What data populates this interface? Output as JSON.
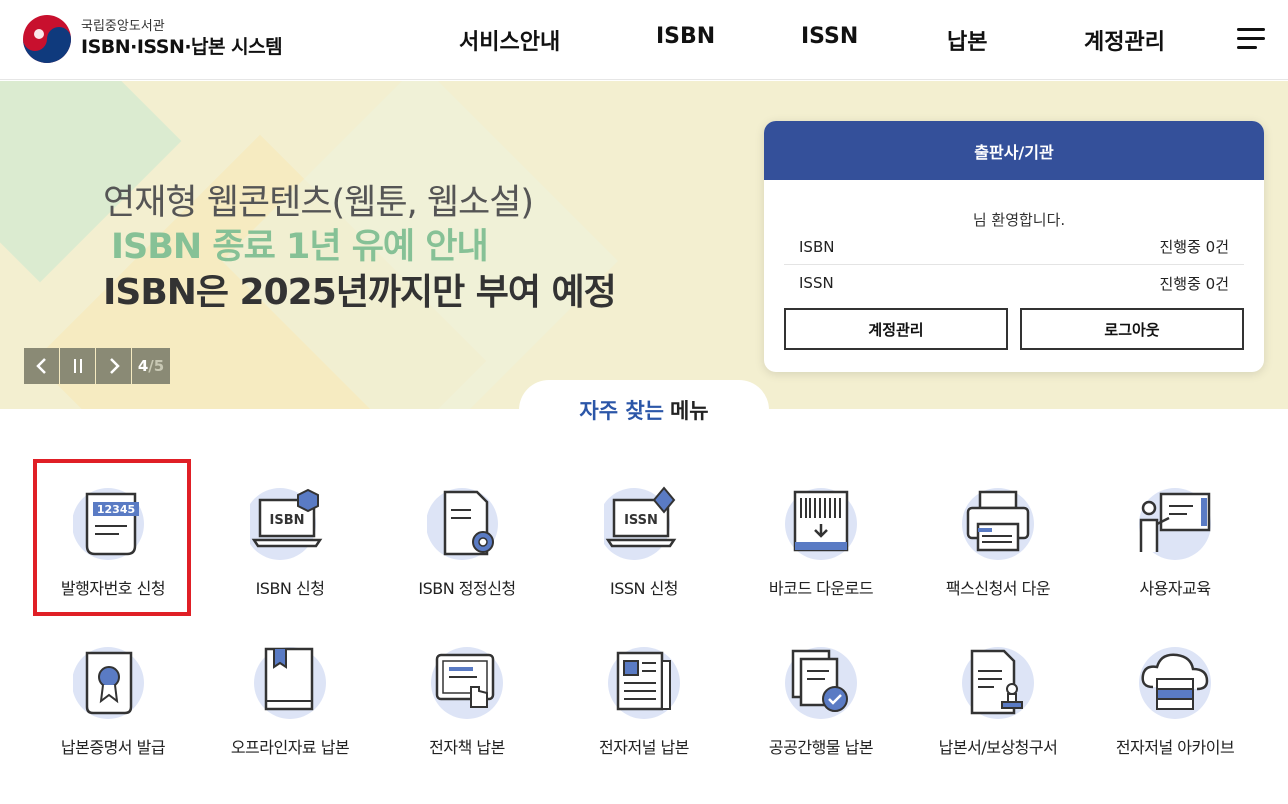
{
  "header": {
    "logo_small": "국립중앙도서관",
    "logo_main": "ISBN·ISSN·납본 시스템",
    "nav": [
      "서비스안내",
      "ISBN",
      "ISSN",
      "납본",
      "계정관리"
    ],
    "menu_icon": "hamburger-icon"
  },
  "banner": {
    "line1": "연재형 웹콘텐츠(웹툰, 웹소설)",
    "line2": "ISBN 종료 1년 유예 안내",
    "line3": "ISBN은 2025년까지만 부여 예정",
    "page_current": "4",
    "page_total": "/5"
  },
  "login_card": {
    "title": "출판사/기관",
    "welcome": "님 환영합니다.",
    "rows": [
      {
        "label": "ISBN",
        "status": "진행중 0건"
      },
      {
        "label": "ISSN",
        "status": "진행중 0건"
      }
    ],
    "account_button": "계정관리",
    "logout_button": "로그아웃"
  },
  "frequent_menu": {
    "title_highlight": "자주 찾는",
    "title_rest": "메뉴",
    "items": [
      {
        "label": "발행자번호 신청",
        "icon": "publisher-number-icon"
      },
      {
        "label": "ISBN 신청",
        "icon": "isbn-laptop-icon"
      },
      {
        "label": "ISBN 정정신청",
        "icon": "document-gear-icon"
      },
      {
        "label": "ISSN 신청",
        "icon": "issn-laptop-icon"
      },
      {
        "label": "바코드 다운로드",
        "icon": "barcode-download-icon"
      },
      {
        "label": "팩스신청서 다운",
        "icon": "fax-icon"
      },
      {
        "label": "사용자교육",
        "icon": "presentation-icon"
      },
      {
        "label": "납본증명서 발급",
        "icon": "certificate-icon"
      },
      {
        "label": "오프라인자료 납본",
        "icon": "book-icon"
      },
      {
        "label": "전자책 납본",
        "icon": "tablet-touch-icon"
      },
      {
        "label": "전자저널 납본",
        "icon": "journal-icon"
      },
      {
        "label": "공공간행물 납본",
        "icon": "documents-check-icon"
      },
      {
        "label": "납본서/보상청구서",
        "icon": "document-stamp-icon"
      },
      {
        "label": "전자저널 아카이브",
        "icon": "cloud-server-icon"
      }
    ]
  },
  "colors": {
    "brand_blue": "#34509a",
    "icon_circle": "#dde4f6",
    "highlight_red": "#e01f26",
    "banner_green": "#86c196"
  }
}
